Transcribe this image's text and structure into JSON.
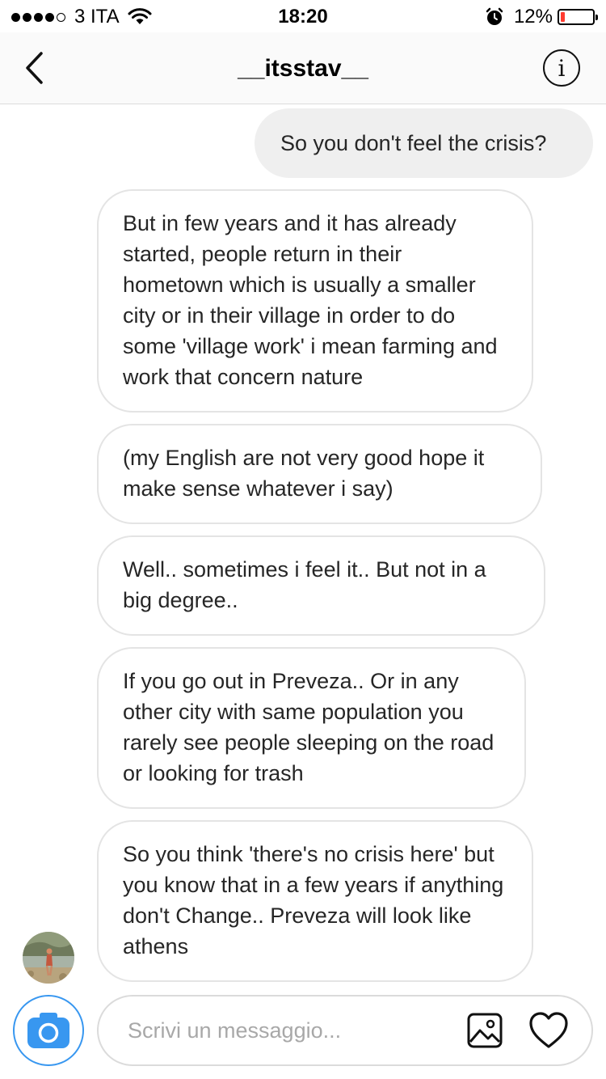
{
  "status_bar": {
    "carrier": "3 ITA",
    "time": "18:20",
    "battery": "12%",
    "icons": [
      "signal-dots-icon",
      "wifi-icon",
      "alarm-icon",
      "battery-icon"
    ]
  },
  "header": {
    "title": "__itsstav__",
    "icons": [
      "chevron-left-icon",
      "info-icon"
    ]
  },
  "info_glyph": "i",
  "messages": [
    {
      "from": "me",
      "text": "So you don't feel the crisis?"
    },
    {
      "from": "them",
      "text": "But in few years and it has already started, people return in their hometown which is usually a smaller city or in their village in order to do some 'village work' i mean farming and work that concern nature"
    },
    {
      "from": "them",
      "text": "(my English are not very good hope it make sense whatever i say)"
    },
    {
      "from": "them",
      "text": "Well.. sometimes i feel it.. But not in a big degree.."
    },
    {
      "from": "them",
      "text": "If you go out in Preveza.. Or in any other city with same population you rarely see people sleeping on the road or looking for trash"
    },
    {
      "from": "them",
      "text": "So you think 'there's no crisis here' but you know that in a few years if anything don't Change.. Preveza will look like athens"
    }
  ],
  "composer": {
    "placeholder": "Scrivi un messaggio...",
    "value": "",
    "icons": [
      "camera-icon",
      "image-icon",
      "heart-icon"
    ]
  },
  "colors": {
    "accent": "#3897f0",
    "sent_bubble": "#efefef",
    "received_border": "#e4e4e4",
    "battery_low": "#ff3b30"
  }
}
